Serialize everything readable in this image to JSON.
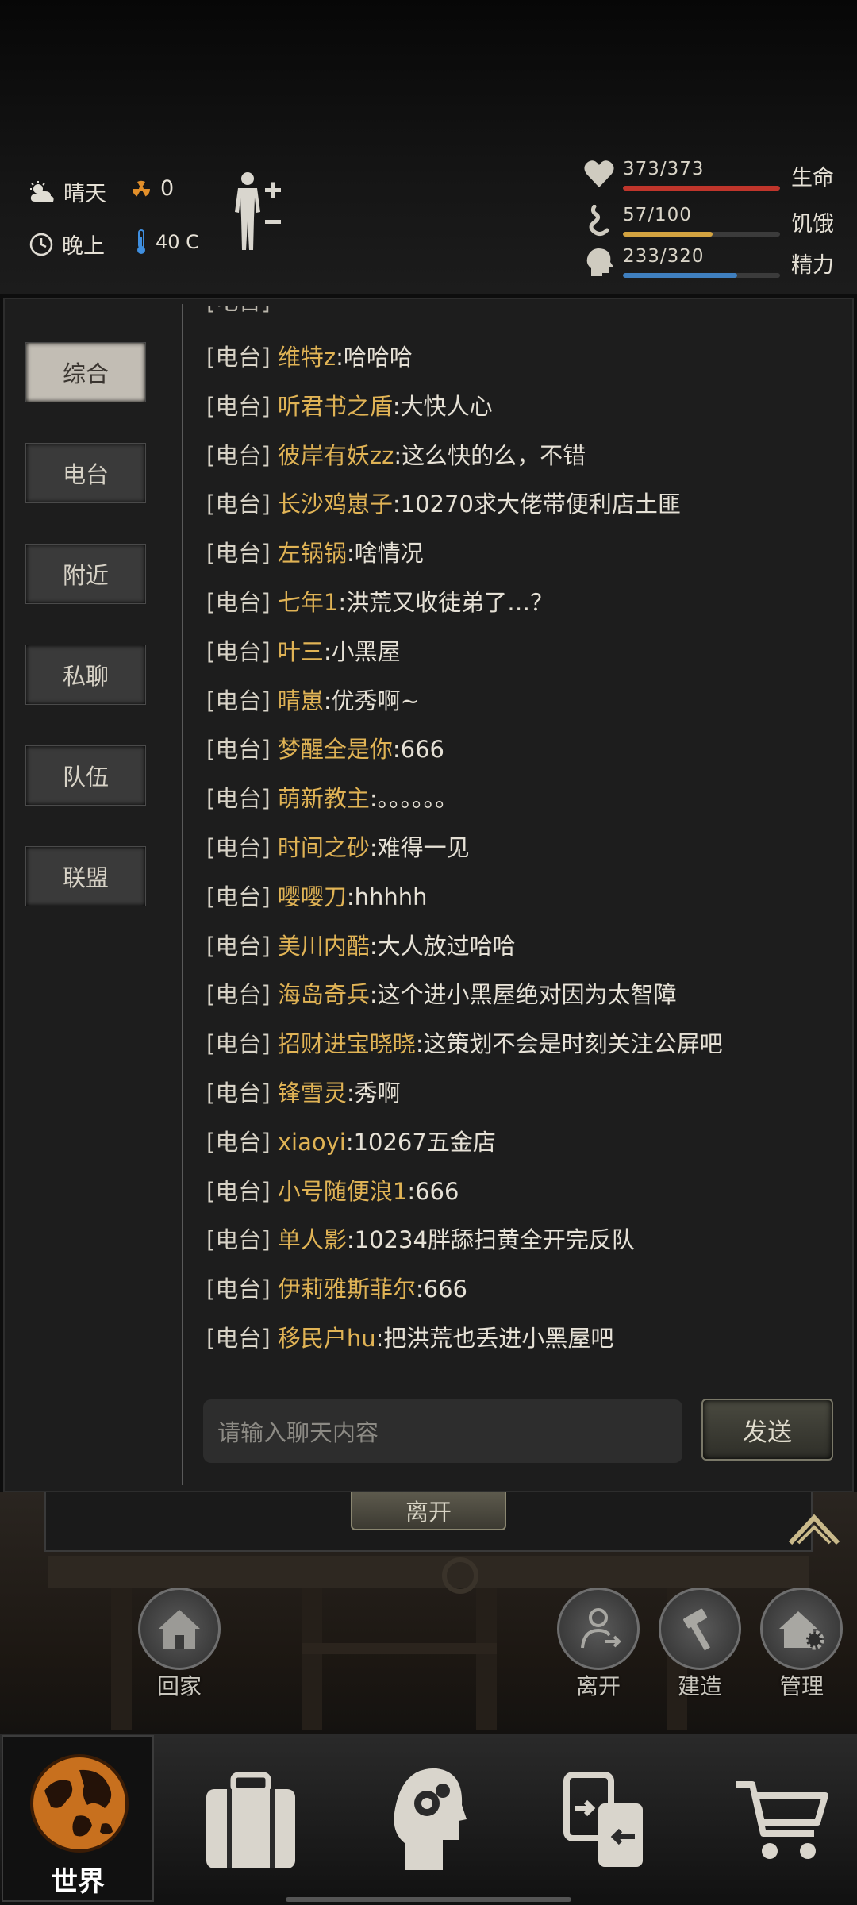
{
  "status": {
    "weather": "晴天",
    "radiation": "0",
    "time_of_day": "晚上",
    "temperature": "40 C"
  },
  "vitals": [
    {
      "name": "生命",
      "value": "373/373",
      "ratio": 1.0,
      "color": "#c0352b"
    },
    {
      "name": "饥饿",
      "value": "57/100",
      "ratio": 0.57,
      "color": "#d3a340"
    },
    {
      "name": "精力",
      "value": "233/320",
      "ratio": 0.728,
      "color": "#3f7fbf"
    }
  ],
  "chat": {
    "tabs": [
      "综合",
      "电台",
      "附近",
      "私聊",
      "队伍",
      "联盟"
    ],
    "active_tab": "综合",
    "messages": [
      {
        "tag": "[电台]",
        "user": "维特z",
        "text": ":哈哈哈"
      },
      {
        "tag": "[电台]",
        "user": "听君书之盾",
        "text": ":大快人心"
      },
      {
        "tag": "[电台]",
        "user": "彼岸有妖zz",
        "text": ":这么快的么，不错"
      },
      {
        "tag": "[电台]",
        "user": "长沙鸡崽子",
        "text": ":10270求大佬带便利店土匪"
      },
      {
        "tag": "[电台]",
        "user": "左锅锅",
        "text": ":啥情况"
      },
      {
        "tag": "[电台]",
        "user": "七年1",
        "text": ":洪荒又收徒弟了…？"
      },
      {
        "tag": "[电台]",
        "user": "叶三",
        "text": ":小黑屋"
      },
      {
        "tag": "[电台]",
        "user": "晴崽",
        "text": ":优秀啊~"
      },
      {
        "tag": "[电台]",
        "user": "梦醒全是你",
        "text": ":666"
      },
      {
        "tag": "[电台]",
        "user": "萌新教主",
        "text": ":。。。。。。"
      },
      {
        "tag": "[电台]",
        "user": "时间之砂",
        "text": ":难得一见"
      },
      {
        "tag": "[电台]",
        "user": "嘤嘤刀",
        "text": ":hhhhh"
      },
      {
        "tag": "[电台]",
        "user": "美川内酷",
        "text": ":大人放过哈哈"
      },
      {
        "tag": "[电台]",
        "user": "海岛奇兵",
        "text": ":这个进小黑屋绝对因为太智障"
      },
      {
        "tag": "[电台]",
        "user": "招财进宝晓晓",
        "text": ":这策划不会是时刻关注公屏吧"
      },
      {
        "tag": "[电台]",
        "user": "锋雪灵",
        "text": ":秀啊"
      },
      {
        "tag": "[电台]",
        "user": "xiaoyi",
        "text": ":10267五金店"
      },
      {
        "tag": "[电台]",
        "user": "小号随便浪1",
        "text": ":666"
      },
      {
        "tag": "[电台]",
        "user": "单人影",
        "text": ":10234胖舔扫黄全开完反队"
      },
      {
        "tag": "[电台]",
        "user": "伊莉雅斯菲尔",
        "text": ":666"
      },
      {
        "tag": "[电台]",
        "user": "移民户hu",
        "text": ":把洪荒也丢进小黑屋吧"
      }
    ],
    "input_placeholder": "请输入聊天内容",
    "send_label": "发送"
  },
  "scene": {
    "leave_label": "离开",
    "actions": [
      "回家",
      "离开",
      "建造",
      "管理"
    ]
  },
  "nav": {
    "world_label": "世界",
    "items": [
      "globe-icon",
      "backpack-icon",
      "skills-icon",
      "trade-icon",
      "shop-icon"
    ]
  }
}
